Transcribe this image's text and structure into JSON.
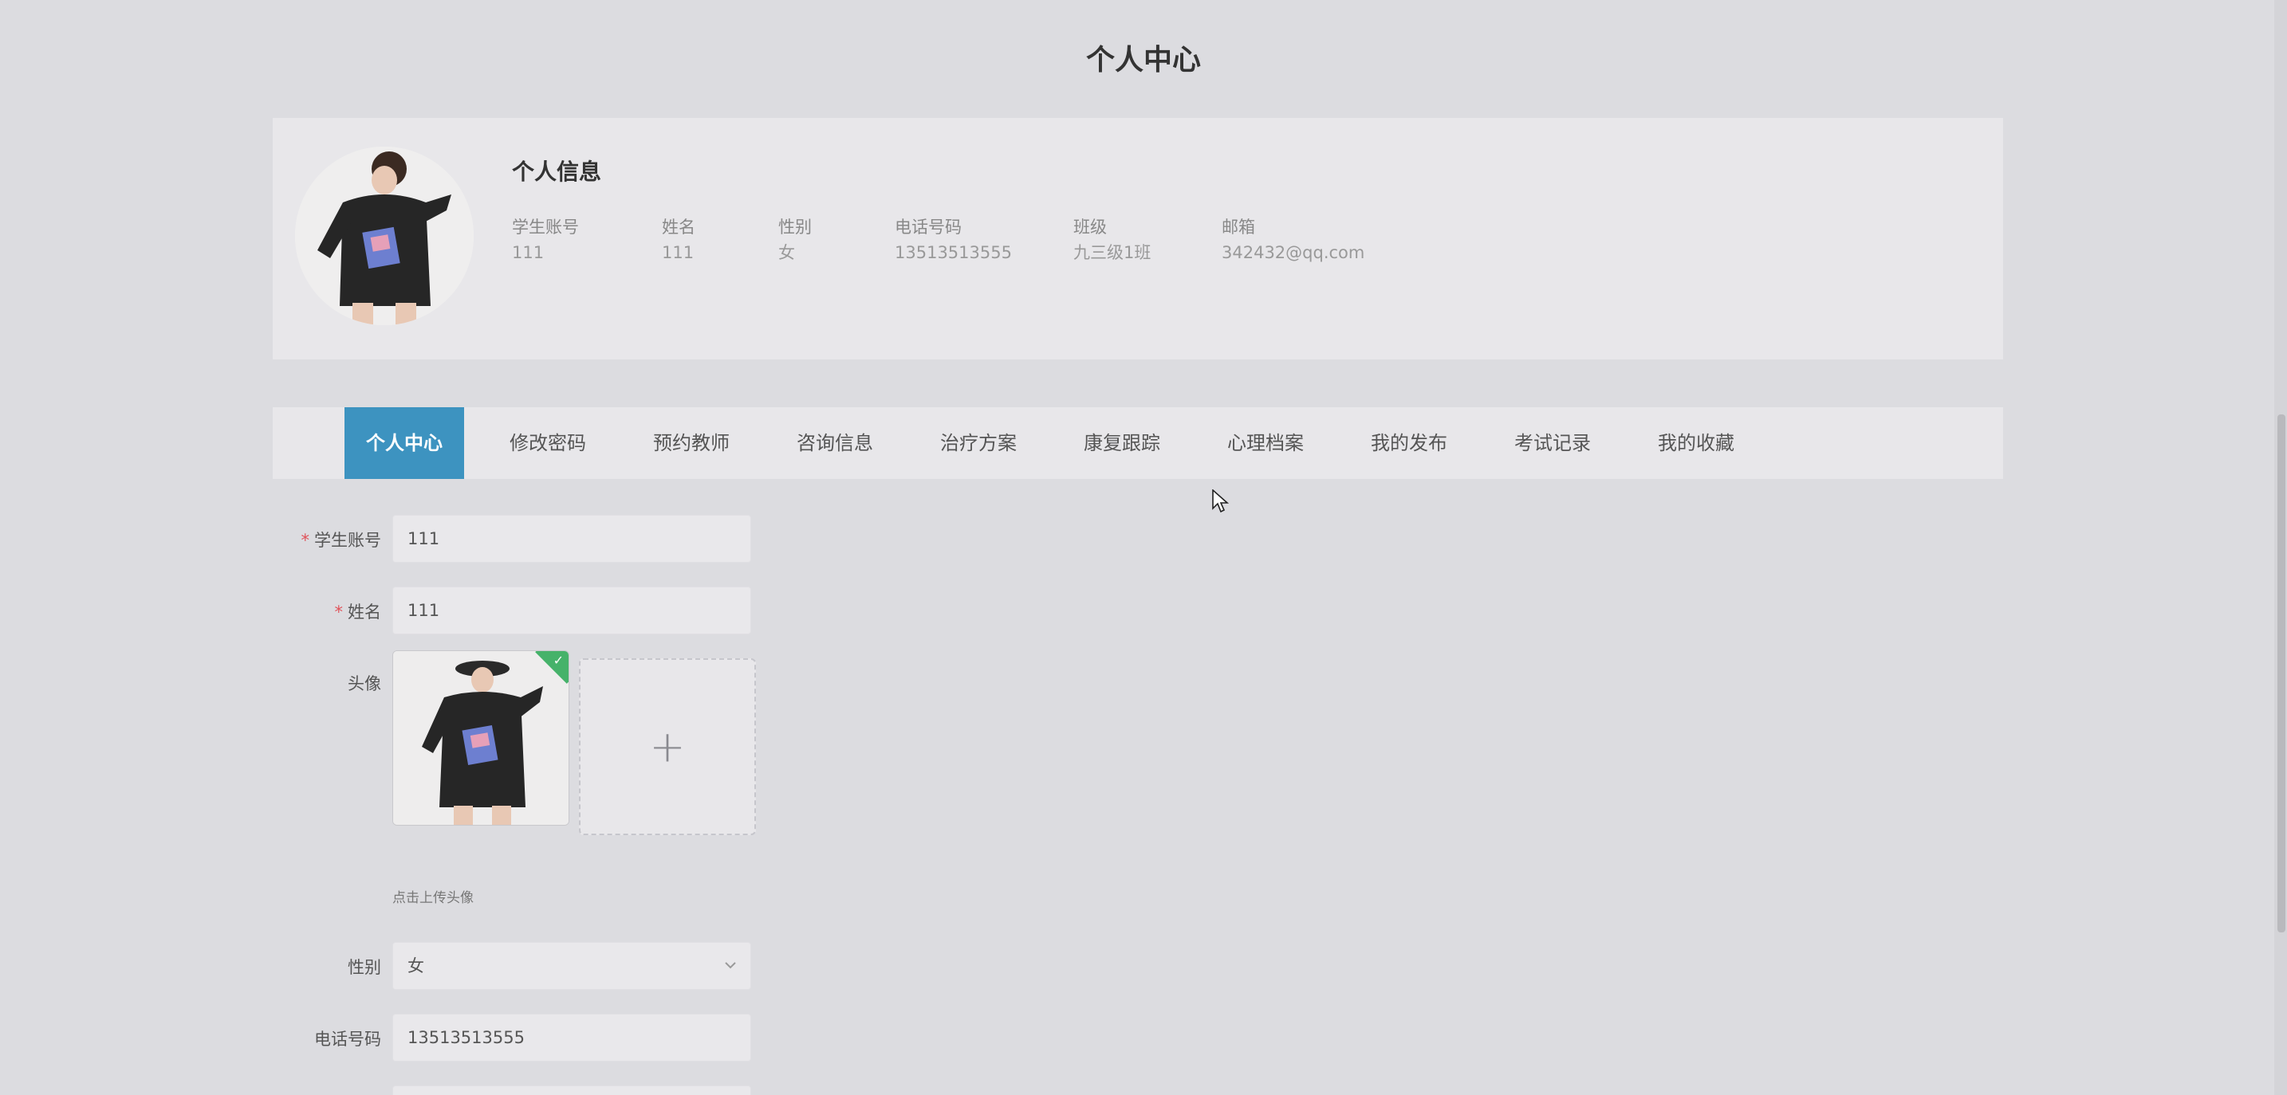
{
  "page": {
    "title": "个人中心"
  },
  "info_card": {
    "heading": "个人信息",
    "fields": [
      {
        "label": "学生账号",
        "value": "111"
      },
      {
        "label": "姓名",
        "value": "111"
      },
      {
        "label": "性别",
        "value": "女"
      },
      {
        "label": "电话号码",
        "value": "13513513555"
      },
      {
        "label": "班级",
        "value": "九三级1班"
      },
      {
        "label": "邮箱",
        "value": "342432@qq.com"
      }
    ]
  },
  "tabs": [
    {
      "label": "个人中心",
      "active": true
    },
    {
      "label": "修改密码"
    },
    {
      "label": "预约教师"
    },
    {
      "label": "咨询信息"
    },
    {
      "label": "治疗方案"
    },
    {
      "label": "康复跟踪"
    },
    {
      "label": "心理档案"
    },
    {
      "label": "我的发布"
    },
    {
      "label": "考试记录"
    },
    {
      "label": "我的收藏"
    }
  ],
  "form": {
    "required_mark": "*",
    "student_account": {
      "label": "学生账号",
      "value": "111"
    },
    "name": {
      "label": "姓名",
      "value": "111"
    },
    "avatar": {
      "label": "头像",
      "hint": "点击上传头像",
      "add_symbol": "+",
      "check_symbol": "✓"
    },
    "gender": {
      "label": "性别",
      "value": "女"
    },
    "phone": {
      "label": "电话号码",
      "value": "13513513555"
    }
  },
  "colors": {
    "active_tab": "#3d93c0",
    "required": "#e0535a",
    "upload_success": "#46b26a"
  }
}
